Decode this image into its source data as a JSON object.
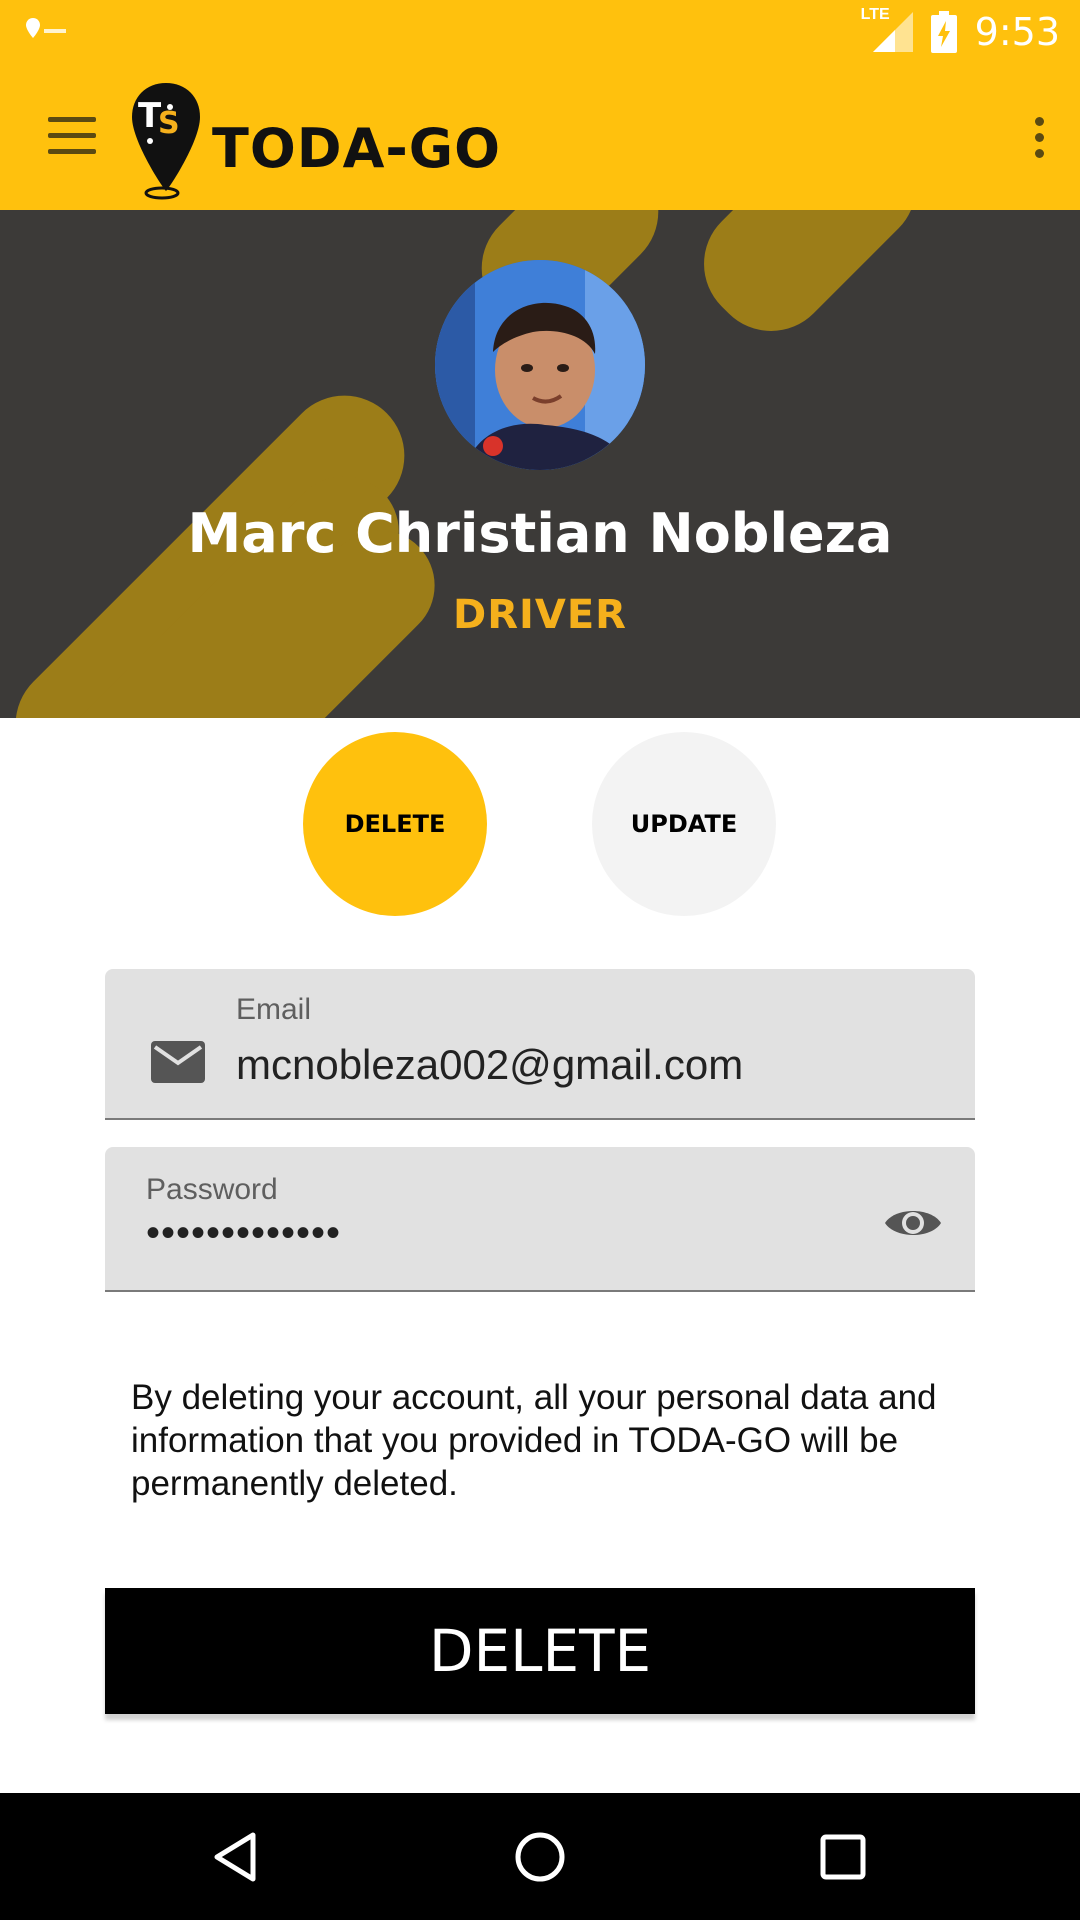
{
  "status_bar": {
    "time": "9:53",
    "network": "LTE",
    "notification_icon": "map-pin-icon"
  },
  "app_bar": {
    "brand": "TODA-GO",
    "menu_icon": "hamburger-menu-icon",
    "more_icon": "more-vert-icon"
  },
  "profile": {
    "name": "Marc Christian Nobleza",
    "role": "DRIVER"
  },
  "actions": {
    "delete_circle_label": "DELETE",
    "update_circle_label": "UPDATE",
    "active": "DELETE"
  },
  "form": {
    "email": {
      "label": "Email",
      "value": "mcnobleza002@gmail.com"
    },
    "password": {
      "label": "Password",
      "value": "•••••••••••••"
    }
  },
  "notice": "By deleting your account, all your personal data and information that you provided in TODA-GO will be permanently deleted.",
  "delete_button_label": "DELETE",
  "colors": {
    "primary": "#FFC10D",
    "header_bg": "#3c3a38",
    "role_text": "#F5B01C",
    "stripe": "#9c7d18"
  }
}
